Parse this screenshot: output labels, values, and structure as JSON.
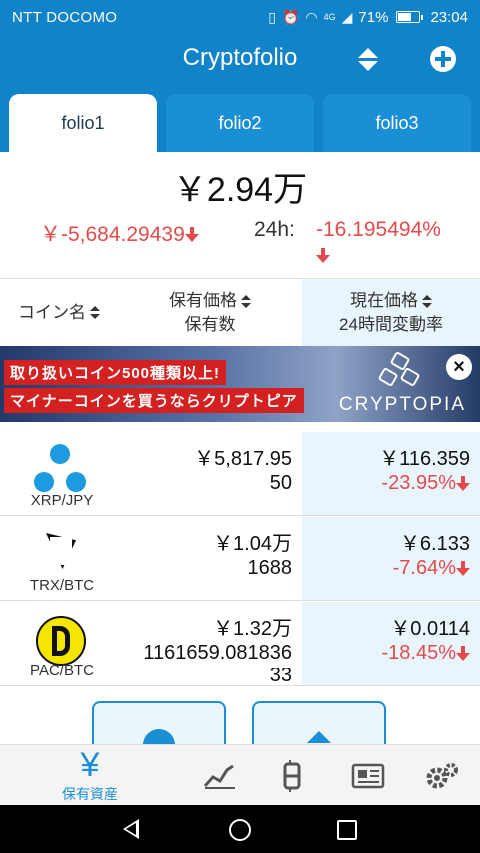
{
  "status_bar": {
    "carrier": "NTT DOCOMO",
    "network": "4G",
    "battery": "71%",
    "battery_level": 0.71,
    "time": "23:04",
    "icons": [
      "vibrate-icon",
      "alarm-icon",
      "wifi-icon",
      "signal-icon",
      "battery-icon"
    ]
  },
  "app_bar": {
    "title": "Cryptofolio",
    "sort_icon": "sort-updown-icon",
    "add_icon": "add-circle-icon"
  },
  "tabs": [
    {
      "label": "folio1",
      "active": true
    },
    {
      "label": "folio2",
      "active": false
    },
    {
      "label": "folio3",
      "active": false
    }
  ],
  "summary": {
    "total": "￥2.94万",
    "profit_loss": "￥-5,684.29439",
    "h24_label": "24h:",
    "h24_change": "-16.195494%"
  },
  "table_header": {
    "col1": "コイン名",
    "col2_line1": "保有価格",
    "col2_line2": "保有数",
    "col3_line1": "現在価格",
    "col3_line2": "24時間変動率"
  },
  "banner": {
    "line1": "取り扱いコイン500種類以上!",
    "line2": "マイナーコインを買うならクリプトピア",
    "brand": "CRYPTOPIA",
    "close": "×"
  },
  "coins": [
    {
      "symbol": "XRP/JPY",
      "holding_value": "￥5,817.95",
      "quantity": "50",
      "quantity2": "",
      "price": "￥116.359",
      "change": "-23.95%",
      "logo": "xrp-logo-icon"
    },
    {
      "symbol": "TRX/BTC",
      "holding_value": "￥1.04万",
      "quantity": "1688",
      "quantity2": "",
      "price": "￥6.133",
      "change": "-7.64%",
      "logo": "tron-logo-icon"
    },
    {
      "symbol": "PAC/BTC",
      "holding_value": "￥1.32万",
      "quantity": "1161659.081836",
      "quantity2": "33",
      "price": "￥0.0114",
      "change": "-18.45%",
      "logo": "paccoin-logo-icon"
    }
  ],
  "bottom_nav": {
    "active_label": "保有資産",
    "active_icon": "yen-icon",
    "items": [
      "chart-icon",
      "bitcoin-icon",
      "news-icon",
      "settings-icon"
    ]
  },
  "colors": {
    "primary": "#1183c8",
    "negative": "#e24b4b",
    "highlight_column": "#e9f5fc"
  }
}
